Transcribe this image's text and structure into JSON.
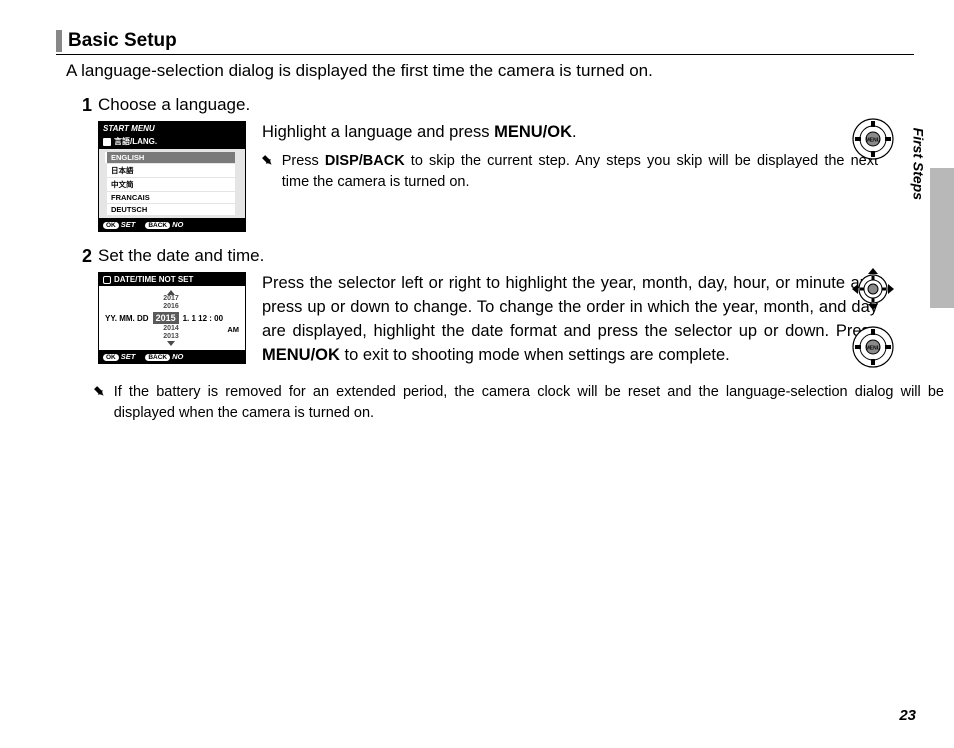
{
  "section_title": "Basic Setup",
  "intro": "A language-selection dialog is displayed the first time the camera is turned on.",
  "side_label": "First Steps",
  "page_number": "23",
  "step1": {
    "num": "1",
    "heading": "Choose a language.",
    "text_a": "Highlight a language and press ",
    "text_b": "MENU/OK",
    "text_c": ".",
    "tip_a": "Press ",
    "tip_b": "DISP/BACK",
    "tip_c": " to skip the current step.  Any steps you skip will be displayed the next time the camera is turned on.",
    "lcd": {
      "header": "START MENU",
      "sub": "言語/LANG.",
      "items": [
        "ENGLISH",
        "日本語",
        "中文简",
        "FRANCAIS",
        "DEUTSCH"
      ],
      "foot_set": "SET",
      "foot_no": "NO",
      "pill_ok": "OK",
      "pill_back": "BACK"
    }
  },
  "step2": {
    "num": "2",
    "heading": "Set the date and time.",
    "text_a": "Press the selector left or right to highlight the year, month, day, hour, or minute and press up or down to change.  To change the order in which the year, month, and day are displayed, highlight the date format and press the selector up or down.  Press ",
    "text_b": "MENU/OK",
    "text_c": " to exit to shooting mode when settings are complete.",
    "lcd": {
      "header": "DATE/TIME NOT SET",
      "years_above": [
        "2017",
        "2016"
      ],
      "year_sel": "2015",
      "years_below": [
        "2014",
        "2013"
      ],
      "fmt": "YY. MM. DD",
      "rest": "1.  1   12 : 00",
      "ampm": "AM",
      "foot_set": "SET",
      "foot_no": "NO",
      "pill_ok": "OK",
      "pill_back": "BACK"
    }
  },
  "footer_tip": "If the battery is removed for an extended period, the camera clock will be reset and the language-selection dialog will be displayed when the camera is turned on.",
  "tip_marker": "➨"
}
